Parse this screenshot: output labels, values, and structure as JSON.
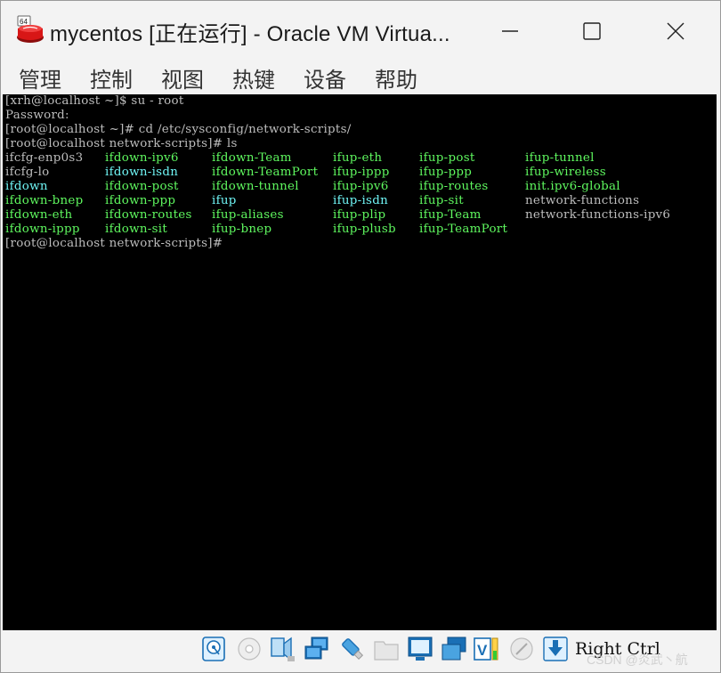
{
  "window": {
    "title": "mycentos [正在运行] - Oracle VM Virtua...",
    "app_icon_badge": "64"
  },
  "menu": [
    {
      "label": "管理"
    },
    {
      "label": "控制"
    },
    {
      "label": "视图"
    },
    {
      "label": "热键"
    },
    {
      "label": "设备"
    },
    {
      "label": "帮助"
    }
  ],
  "console": {
    "lines": [
      "[xrh@localhost ~]$ su - root",
      "Password:",
      "[root@localhost ~]# cd /etc/sysconfig/network-scripts/",
      "[root@localhost network-scripts]# ls"
    ],
    "ls_rows": [
      [
        {
          "text": "ifcfg-enp0s3",
          "color": "plain"
        },
        {
          "text": "ifdown-ipv6",
          "color": "green"
        },
        {
          "text": "ifdown-Team",
          "color": "green"
        },
        {
          "text": "ifup-eth",
          "color": "green"
        },
        {
          "text": "ifup-post",
          "color": "green"
        },
        {
          "text": "ifup-tunnel",
          "color": "green"
        }
      ],
      [
        {
          "text": "ifcfg-lo",
          "color": "plain"
        },
        {
          "text": "ifdown-isdn",
          "color": "cyan"
        },
        {
          "text": "ifdown-TeamPort",
          "color": "green"
        },
        {
          "text": "ifup-ippp",
          "color": "green"
        },
        {
          "text": "ifup-ppp",
          "color": "green"
        },
        {
          "text": "ifup-wireless",
          "color": "green"
        }
      ],
      [
        {
          "text": "ifdown",
          "color": "cyan"
        },
        {
          "text": "ifdown-post",
          "color": "green"
        },
        {
          "text": "ifdown-tunnel",
          "color": "green"
        },
        {
          "text": "ifup-ipv6",
          "color": "green"
        },
        {
          "text": "ifup-routes",
          "color": "green"
        },
        {
          "text": "init.ipv6-global",
          "color": "green"
        }
      ],
      [
        {
          "text": "ifdown-bnep",
          "color": "green"
        },
        {
          "text": "ifdown-ppp",
          "color": "green"
        },
        {
          "text": "ifup",
          "color": "cyan"
        },
        {
          "text": "ifup-isdn",
          "color": "cyan"
        },
        {
          "text": "ifup-sit",
          "color": "green"
        },
        {
          "text": "network-functions",
          "color": "plain"
        }
      ],
      [
        {
          "text": "ifdown-eth",
          "color": "green"
        },
        {
          "text": "ifdown-routes",
          "color": "green"
        },
        {
          "text": "ifup-aliases",
          "color": "green"
        },
        {
          "text": "ifup-plip",
          "color": "green"
        },
        {
          "text": "ifup-Team",
          "color": "green"
        },
        {
          "text": "network-functions-ipv6",
          "color": "plain"
        }
      ],
      [
        {
          "text": "ifdown-ippp",
          "color": "green"
        },
        {
          "text": "ifdown-sit",
          "color": "green"
        },
        {
          "text": "ifup-bnep",
          "color": "green"
        },
        {
          "text": "ifup-plusb",
          "color": "green"
        },
        {
          "text": "ifup-TeamPort",
          "color": "green"
        },
        {
          "text": "",
          "color": "plain"
        }
      ]
    ],
    "final_prompt": "[root@localhost network-scripts]#"
  },
  "statusbar": {
    "icons": [
      "hard-disk-icon",
      "optical-drive-icon",
      "audio-icon",
      "network-icon",
      "usb-icon",
      "shared-folders-icon",
      "display-icon",
      "video-capture-icon",
      "recording-icon",
      "mouse-integration-icon",
      "keyboard-capture-icon"
    ],
    "host_key": "Right Ctrl",
    "watermark": "CSDN @炎武丶航"
  },
  "colors": {
    "console_bg": "#000000",
    "console_text": "#bdbdbd",
    "ls_green": "#5ff85f",
    "ls_cyan": "#6ff5f5",
    "chrome_bg": "#f3f3f3"
  }
}
